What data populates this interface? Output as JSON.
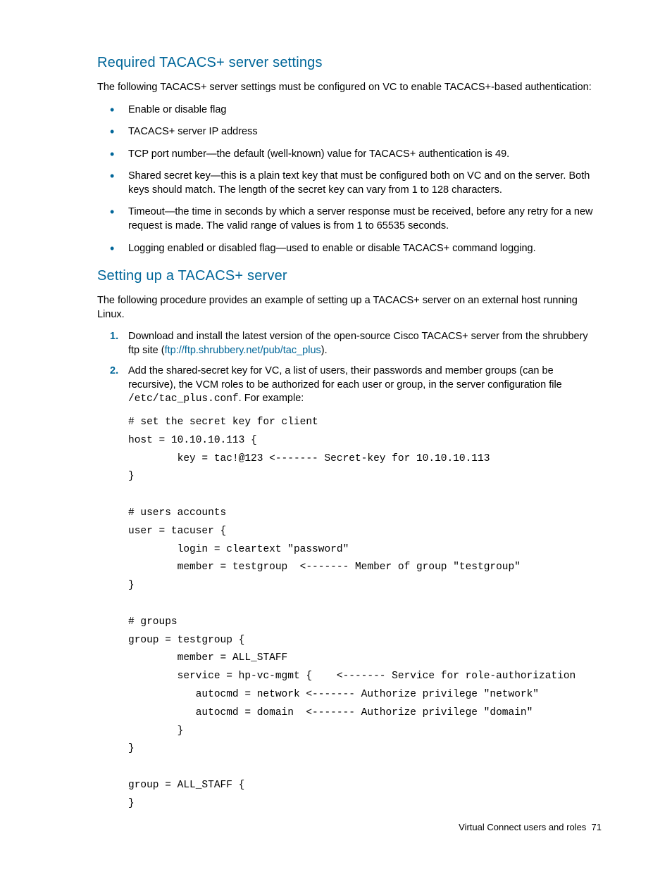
{
  "section1": {
    "heading": "Required TACACS+ server settings",
    "intro": "The following TACACS+ server settings must be configured on VC to enable TACACS+-based authentication:",
    "bullets": [
      "Enable or disable flag",
      "TACACS+ server IP address",
      "TCP port number—the default (well-known) value for TACACS+ authentication is 49.",
      "Shared secret key—this is a plain text key that must be configured both on VC and on the server. Both keys should match. The length of the secret key can vary from 1 to 128 characters.",
      "Timeout—the time in seconds by which a server response must be received, before any retry for a new request is made. The valid range of values is from 1 to 65535 seconds.",
      "Logging enabled or disabled flag—used to enable or disable TACACS+ command logging."
    ]
  },
  "section2": {
    "heading": "Setting up a TACACS+ server",
    "intro": "The following procedure provides an example of setting up a TACACS+ server on an external host running Linux.",
    "steps": {
      "s1_pre": "Download and install the latest version of the open-source Cisco TACACS+ server from the shrubbery ftp site (",
      "s1_link": "ftp://ftp.shrubbery.net/pub/tac_plus",
      "s1_post": ").",
      "s2_pre": "Add the shared-secret key for VC, a list of users, their passwords and member groups (can be recursive), the VCM roles to be authorized for each user or group, in the server configuration file ",
      "s2_path": "/etc/tac_plus.conf",
      "s2_post": ". For example:"
    },
    "code": "# set the secret key for client\nhost = 10.10.10.113 {\n        key = tac!@123 <------- Secret-key for 10.10.10.113\n}\n\n# users accounts\nuser = tacuser {\n        login = cleartext \"password\"\n        member = testgroup  <------- Member of group \"testgroup\"\n}\n\n# groups\ngroup = testgroup {\n        member = ALL_STAFF\n        service = hp-vc-mgmt {    <------- Service for role-authorization\n           autocmd = network <------- Authorize privilege \"network\"\n           autocmd = domain  <------- Authorize privilege \"domain\"\n        }\n}\n\ngroup = ALL_STAFF {\n}"
  },
  "footer": {
    "text": "Virtual Connect users and roles",
    "page": "71"
  }
}
